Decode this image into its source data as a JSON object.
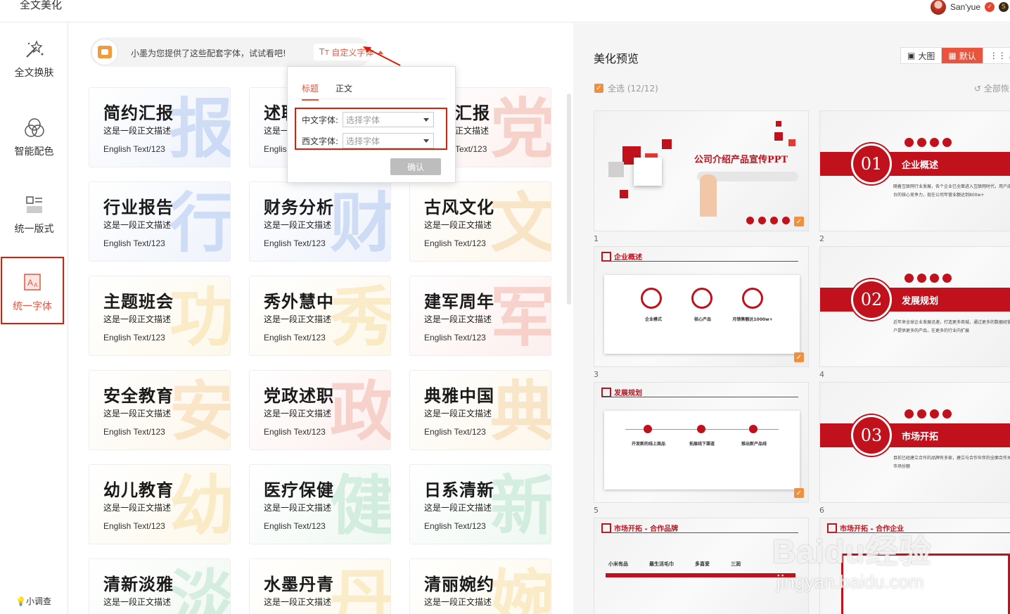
{
  "app": {
    "title": "全文美化"
  },
  "user": {
    "name": "San'yue"
  },
  "leftnav": {
    "items": [
      {
        "label": "全文换肤"
      },
      {
        "label": "智能配色"
      },
      {
        "label": "统一版式"
      },
      {
        "label": "统一字体"
      }
    ],
    "survey": "小调查"
  },
  "tip": {
    "text": "小墨为您提供了这些配套字体，试试看吧!",
    "custom_font": "自定义字体"
  },
  "popup": {
    "tabs": [
      "标题",
      "正文"
    ],
    "cn_label": "中文字体:",
    "cn_placeholder": "选择字体",
    "en_label": "西文字体:",
    "en_placeholder": "选择字体",
    "confirm": "确认"
  },
  "font_cards": [
    {
      "title": "简约汇报",
      "sub": "这是一段正文描述",
      "en": "English Text/123",
      "bg": "报",
      "accent": "#4f7fe0",
      "tint": "#edf2fb"
    },
    {
      "title": "述职",
      "sub": "这是一",
      "en": "English",
      "bg": "",
      "accent": "#4f7fe0",
      "tint": "#f2f4fa"
    },
    {
      "title": "汇报",
      "sub": "正文描述",
      "en": "Text/123",
      "bg": "党",
      "accent": "#e2583f",
      "tint": "#fcf0ee"
    },
    {
      "title": "行业报告",
      "sub": "这是一段正文描述",
      "en": "English Text/123",
      "bg": "行",
      "accent": "#4f7fe0",
      "tint": "#eef3fb"
    },
    {
      "title": "财务分析",
      "sub": "这是一段正文描述",
      "en": "English Text/123",
      "bg": "财",
      "accent": "#4f7fe0",
      "tint": "#edf2fb"
    },
    {
      "title": "古风文化",
      "sub": "这是一段正文描述",
      "en": "English Text/123",
      "bg": "文",
      "accent": "#e8a03a",
      "tint": "#fdf6ea"
    },
    {
      "title": "主题班会",
      "sub": "这是一段正文描述",
      "en": "English Text/123",
      "bg": "功",
      "accent": "#f0b43a",
      "tint": "#fdf8ea"
    },
    {
      "title": "秀外慧中",
      "sub": "这是一段正文描述",
      "en": "English Text/123",
      "bg": "秀",
      "accent": "#f0b43a",
      "tint": "#fdf8ea"
    },
    {
      "title": "建军周年",
      "sub": "这是一段正文描述",
      "en": "English Text/123",
      "bg": "军",
      "accent": "#e2583f",
      "tint": "#fcefed"
    },
    {
      "title": "安全教育",
      "sub": "这是一段正文描述",
      "en": "English Text/123",
      "bg": "安",
      "accent": "#f0a03a",
      "tint": "#fdf6ea"
    },
    {
      "title": "党政述职",
      "sub": "这是一段正文描述",
      "en": "English Text/123",
      "bg": "政",
      "accent": "#e2583f",
      "tint": "#fcefed"
    },
    {
      "title": "典雅中国",
      "sub": "这是一段正文描述",
      "en": "English Text/123",
      "bg": "典",
      "accent": "#e8a03a",
      "tint": "#fdf6ea"
    },
    {
      "title": "幼儿教育",
      "sub": "这是一段正文描述",
      "en": "English Text/123",
      "bg": "幼",
      "accent": "#f0b43a",
      "tint": "#fdf8ea"
    },
    {
      "title": "医疗保健",
      "sub": "这是一段正文描述",
      "en": "English Text/123",
      "bg": "健",
      "accent": "#5fbf8e",
      "tint": "#eef8f2"
    },
    {
      "title": "日系清新",
      "sub": "这是一段正文描述",
      "en": "English Text/123",
      "bg": "新",
      "accent": "#5fbf8e",
      "tint": "#eef8f2"
    },
    {
      "title": "清新淡雅",
      "sub": "这是一段正文描述",
      "en": "",
      "bg": "淡",
      "accent": "#5fbf8e",
      "tint": "#f1f8f2"
    },
    {
      "title": "水墨丹青",
      "sub": "这是一段正文描述",
      "en": "",
      "bg": "丹",
      "accent": "#f0b43a",
      "tint": "#fdf8ea"
    },
    {
      "title": "清丽婉约",
      "sub": "这是一段正文描述",
      "en": "",
      "bg": "婉",
      "accent": "#f0b43a",
      "tint": "#fdf8ea"
    }
  ],
  "preview": {
    "title": "美化预览",
    "view_modes": [
      "大图",
      "默认",
      "小"
    ],
    "select_all": "全选 (12/12)",
    "restore_all": "全部恢",
    "slides": [
      {
        "num": "1",
        "title": "公司介绍产品宣传PPT"
      },
      {
        "num": "2",
        "sec_num": "01",
        "sec_title": "企业概述",
        "body": "随着互联网行业发展，各个企业已全面进入互联网时代，用户成为每个平台的核心竞争力，现在公司年营业额达到800w+"
      },
      {
        "num": "3",
        "tag": "企业概述",
        "items": [
          "企业模式",
          "核心产品",
          "月销售额达1000w+"
        ]
      },
      {
        "num": "4",
        "sec_num": "02",
        "sec_title": "发展规划",
        "body": "近年来全球企业发展迅速，打造更多商城，通过更多的数据经营，如向客户提供更多的产品，在更多的行业内扩展"
      },
      {
        "num": "5",
        "tag": "发展规划",
        "items": [
          "开发新的线上商品",
          "拓展线下渠道",
          "推出新产品线"
        ]
      },
      {
        "num": "6",
        "sec_num": "03",
        "sec_title": "市场开拓",
        "body": "目前已经建立合作的品牌有多家，建立与合作伙伴的全面合作关系，扩大市场份额"
      },
      {
        "num": "",
        "tag": "市场开拓 - 合作品牌",
        "brands": [
          "小米有品",
          "最生活毛巾",
          "多喜爱",
          "三润"
        ]
      },
      {
        "num": "",
        "tag": "市场开拓 - 合作企业"
      }
    ]
  },
  "watermark": {
    "brand": "Baidu经验",
    "url": "jingyan.baidu.com"
  },
  "colors": {
    "accent": "#e8543e",
    "brand_red": "#c0111c",
    "highlight_border": "#d81e06"
  }
}
